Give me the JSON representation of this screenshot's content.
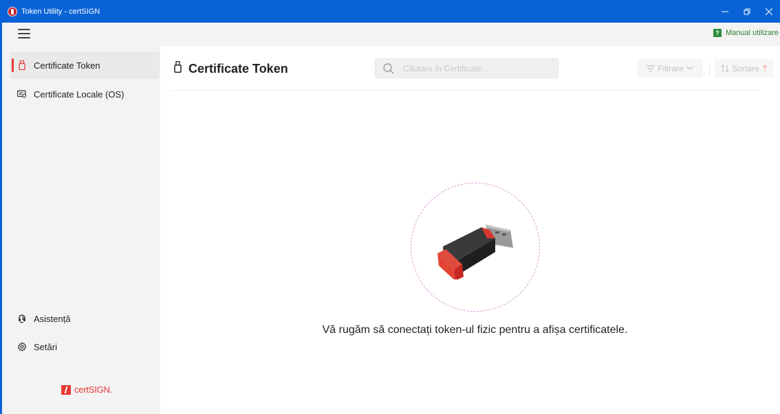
{
  "window": {
    "title": "Token Utility - certSIGN",
    "controls": [
      "minimize",
      "restore",
      "close"
    ]
  },
  "toolbar": {
    "manual_label": "Manual utilizare",
    "manual_icon_glyph": "?"
  },
  "sidebar": {
    "items": [
      {
        "label": "Certificate Token",
        "icon": "usb-token-icon",
        "active": true
      },
      {
        "label": "Certificate Locale (OS)",
        "icon": "local-certificate-icon",
        "active": false
      }
    ],
    "bottom_items": [
      {
        "label": "Asistență",
        "icon": "support-icon"
      },
      {
        "label": "Setări",
        "icon": "gear-icon"
      }
    ],
    "brand": "certSIGN."
  },
  "main": {
    "title": "Certificate Token",
    "search_placeholder": "Căutare în Certificate...",
    "filter_label": "Filtrare",
    "sort_label": "Sortare",
    "empty_message": "Vă rugăm să conectați token-ul fizic pentru a afișa certificatele."
  },
  "colors": {
    "titlebar": "#0a63d6",
    "accent": "#e53935",
    "sidebar_bg": "#f3f3f3",
    "manual_green": "#2e7d32"
  }
}
